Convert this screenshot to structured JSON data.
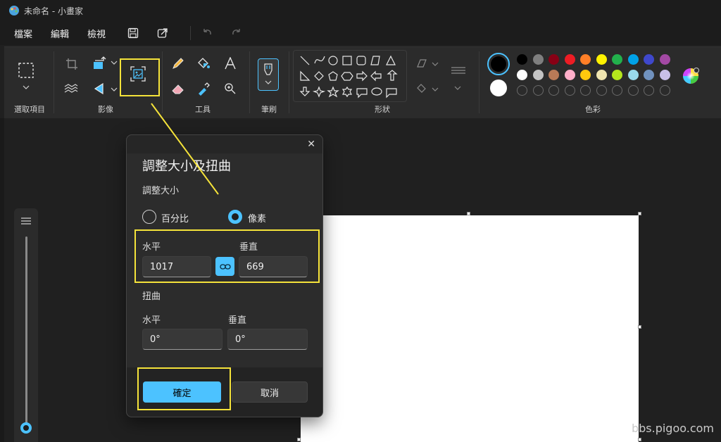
{
  "window": {
    "title": "未命名 - 小畫家"
  },
  "menu": {
    "items": [
      "檔案",
      "編輯",
      "檢視"
    ]
  },
  "ribbon": {
    "groups": {
      "selection": "選取項目",
      "image": "影像",
      "tools": "工具",
      "brushes": "筆刷",
      "shapes": "形狀",
      "colors": "色彩"
    }
  },
  "colors": {
    "row1": [
      "#000000",
      "#7f7f7f",
      "#880015",
      "#ed1c24",
      "#ff7f27",
      "#fff200",
      "#22b14c",
      "#00a2e8",
      "#3f48cc",
      "#a349a4"
    ],
    "row2": [
      "#ffffff",
      "#c3c3c3",
      "#b97a57",
      "#ffaec9",
      "#ffc90e",
      "#efe4b0",
      "#b5e61d",
      "#99d9ea",
      "#7092be",
      "#c8bfe7"
    ],
    "primary": "#000000",
    "secondary": "#ffffff",
    "accent": "#4cc2ff",
    "highlight": "#f5e33a"
  },
  "dialog": {
    "title": "調整大小及扭曲",
    "resize_label": "調整大小",
    "radio_percent": "百分比",
    "radio_pixels": "像素",
    "selected_unit": "像素",
    "resize_h_label": "水平",
    "resize_v_label": "垂直",
    "resize_h_value": "1017",
    "resize_v_value": "669",
    "skew_label": "扭曲",
    "skew_h_label": "水平",
    "skew_v_label": "垂直",
    "skew_h_value": "0°",
    "skew_v_value": "0°",
    "ok": "確定",
    "cancel": "取消"
  },
  "watermark": "bbs.pigoo.com"
}
